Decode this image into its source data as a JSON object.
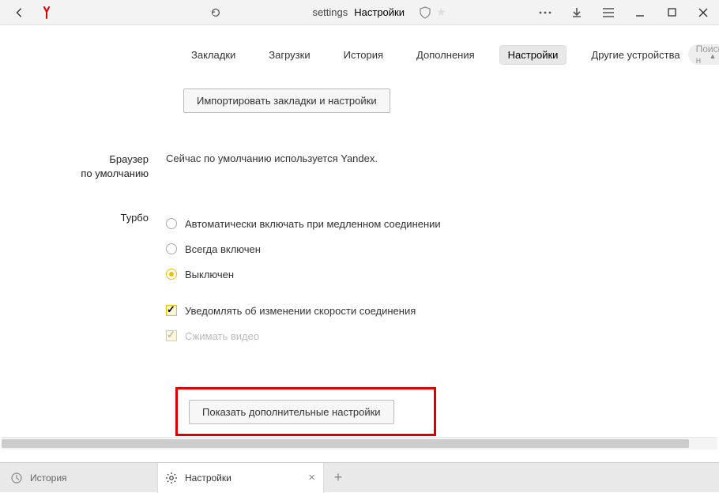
{
  "address": {
    "path": "settings",
    "title": "Настройки"
  },
  "tabs": {
    "items": [
      {
        "label": "Закладки"
      },
      {
        "label": "Загрузки"
      },
      {
        "label": "История"
      },
      {
        "label": "Дополнения"
      },
      {
        "label": "Настройки",
        "active": true
      },
      {
        "label": "Другие устройства"
      }
    ]
  },
  "search": {
    "placeholder": "Поиск н"
  },
  "import_button": "Импортировать закладки и настройки",
  "default_browser": {
    "label": "Браузер\nпо умолчанию",
    "status": "Сейчас по умолчанию используется Yandex."
  },
  "turbo": {
    "label": "Турбо",
    "options": [
      {
        "label": "Автоматически включать при медленном соединении",
        "selected": false
      },
      {
        "label": "Всегда включен",
        "selected": false
      },
      {
        "label": "Выключен",
        "selected": true
      }
    ],
    "checks": [
      {
        "label": "Уведомлять об изменении скорости соединения",
        "checked": true,
        "disabled": false
      },
      {
        "label": "Сжимать видео",
        "checked": true,
        "disabled": true
      }
    ]
  },
  "advanced_button": "Показать дополнительные настройки",
  "bottombar": {
    "history_label": "История",
    "active_tab": "Настройки"
  }
}
